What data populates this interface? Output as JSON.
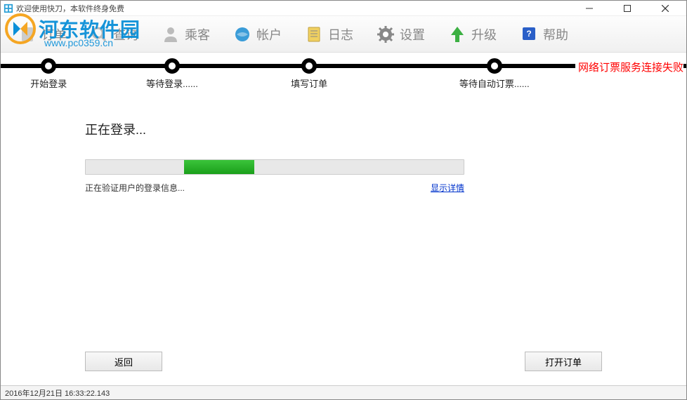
{
  "window": {
    "title": "欢迎使用快刀，本软件终身免费"
  },
  "watermark": {
    "brand": "河东软件园",
    "url": "www.pc0359.cn"
  },
  "toolbar": {
    "items": [
      {
        "label": "订单"
      },
      {
        "label": "查询"
      },
      {
        "label": "乘客"
      },
      {
        "label": "帐户"
      },
      {
        "label": "日志"
      },
      {
        "label": "设置"
      },
      {
        "label": "升级"
      },
      {
        "label": "帮助"
      }
    ]
  },
  "steps": {
    "items": [
      {
        "label": "开始登录",
        "x": 7
      },
      {
        "label": "等待登录......",
        "x": 25
      },
      {
        "label": "填写订单",
        "x": 45
      },
      {
        "label": "等待自动订票......",
        "x": 72
      }
    ],
    "error": "网络订票服务连接失败"
  },
  "main": {
    "title": "正在登录...",
    "verify_text": "正在验证用户的登录信息...",
    "detail_link": "显示详情"
  },
  "buttons": {
    "back": "返回",
    "open_order": "打开订单"
  },
  "statusbar": {
    "timestamp": "2016年12月21日 16:33:22.143"
  }
}
